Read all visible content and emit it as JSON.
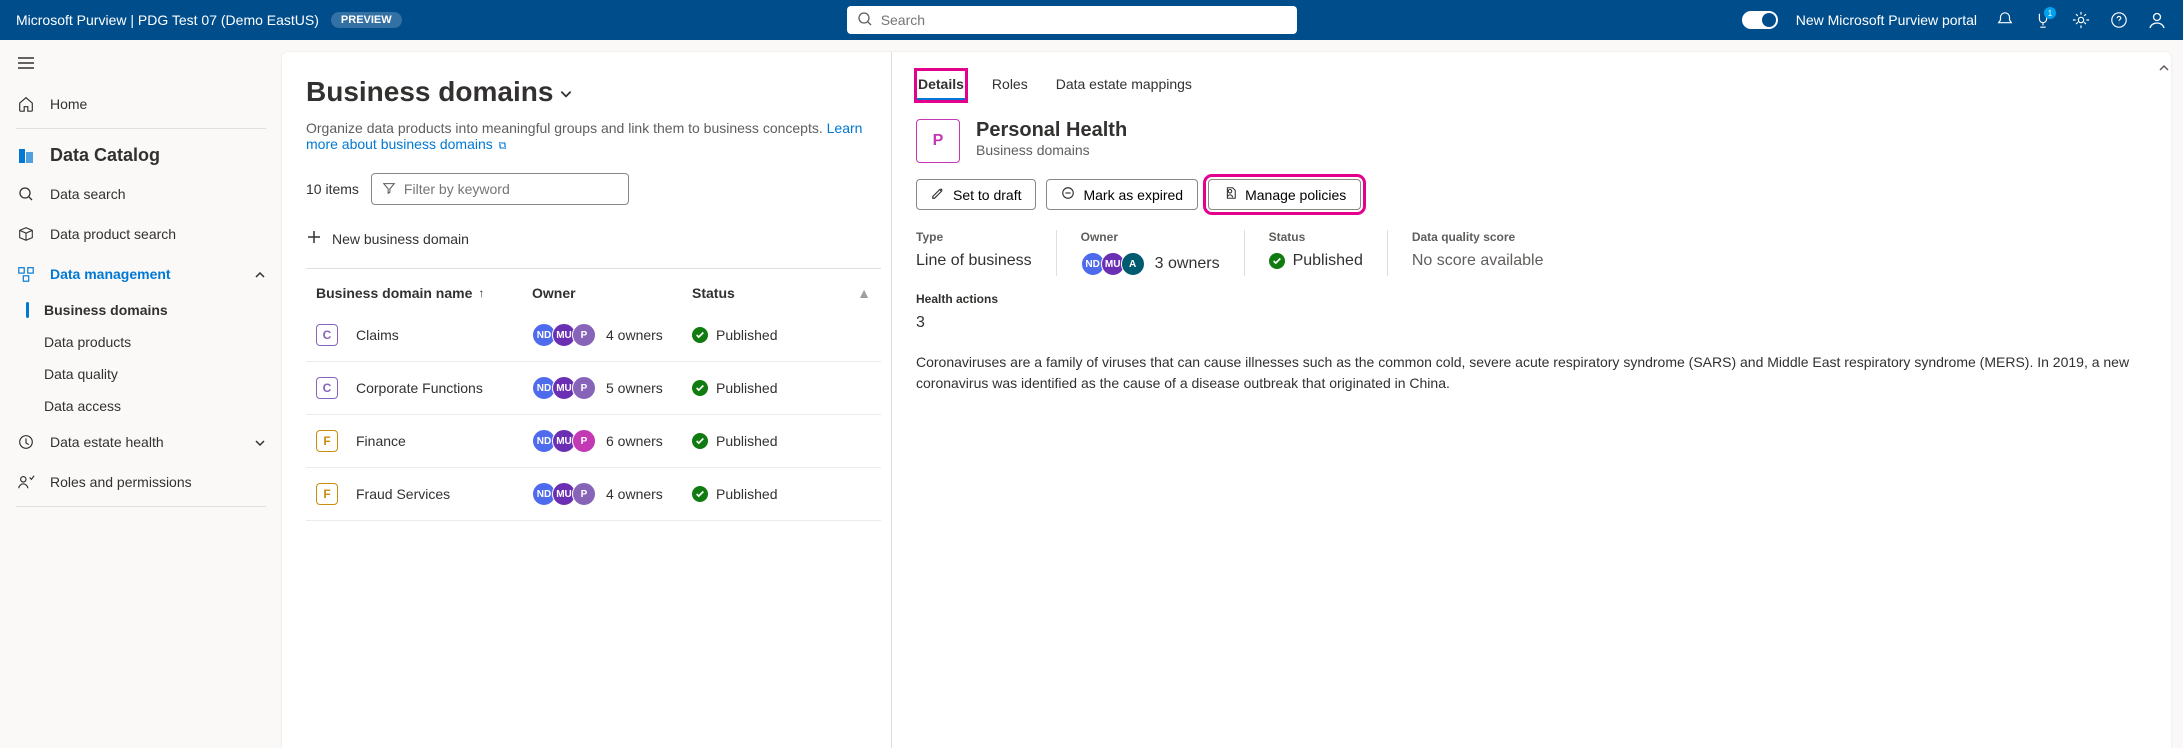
{
  "header": {
    "title": "Microsoft Purview | PDG Test 07 (Demo EastUS)",
    "preview_badge": "PREVIEW",
    "search_placeholder": "Search",
    "portal_label": "New Microsoft Purview portal",
    "notif_count": "1"
  },
  "sidebar": {
    "home": "Home",
    "section_title": "Data Catalog",
    "items": [
      {
        "label": "Data search"
      },
      {
        "label": "Data product search"
      },
      {
        "label": "Data management"
      },
      {
        "label": "Data estate health"
      },
      {
        "label": "Roles and permissions"
      }
    ],
    "sub_items": [
      {
        "label": "Business domains"
      },
      {
        "label": "Data products"
      },
      {
        "label": "Data quality"
      },
      {
        "label": "Data access"
      }
    ]
  },
  "list": {
    "heading": "Business domains",
    "description": "Organize data products into meaningful groups and link them to business concepts. ",
    "learn_more": "Learn more about business domains",
    "item_count": "10 items",
    "filter_placeholder": "Filter by keyword",
    "new_button": "New business domain",
    "columns": {
      "name": "Business domain name",
      "owner": "Owner",
      "status": "Status"
    },
    "rows": [
      {
        "letter": "C",
        "letter_class": "letter-c",
        "name": "Claims",
        "owners": "4 owners",
        "status": "Published",
        "avatars": [
          "ND",
          "MU",
          "P"
        ],
        "p_class": "av-p"
      },
      {
        "letter": "C",
        "letter_class": "letter-c",
        "name": "Corporate Functions",
        "owners": "5 owners",
        "status": "Published",
        "avatars": [
          "ND",
          "MU",
          "P"
        ],
        "p_class": "av-p"
      },
      {
        "letter": "F",
        "letter_class": "letter-f",
        "name": "Finance",
        "owners": "6 owners",
        "status": "Published",
        "avatars": [
          "ND",
          "MU",
          "P"
        ],
        "p_class": "av-p2"
      },
      {
        "letter": "F",
        "letter_class": "letter-f",
        "name": "Fraud Services",
        "owners": "4 owners",
        "status": "Published",
        "avatars": [
          "ND",
          "MU",
          "P"
        ],
        "p_class": "av-p"
      }
    ]
  },
  "detail": {
    "tabs": [
      {
        "label": "Details",
        "active": true,
        "highlight": true
      },
      {
        "label": "Roles"
      },
      {
        "label": "Data estate mappings"
      }
    ],
    "letter": "P",
    "title": "Personal Health",
    "subtitle": "Business domains",
    "actions": {
      "draft": "Set to draft",
      "expired": "Mark as expired",
      "policies": "Manage policies"
    },
    "meta": {
      "type_label": "Type",
      "type_value": "Line of business",
      "owner_label": "Owner",
      "owner_value": "3 owners",
      "status_label": "Status",
      "status_value": "Published",
      "quality_label": "Data quality score",
      "quality_value": "No score available"
    },
    "health_label": "Health actions",
    "health_value": "3",
    "description": "Coronaviruses are a family of viruses that can cause illnesses such as the common cold, severe acute respiratory syndrome (SARS) and Middle East respiratory syndrome (MERS). In 2019, a new coronavirus was identified as the cause of a disease outbreak that originated in China."
  }
}
